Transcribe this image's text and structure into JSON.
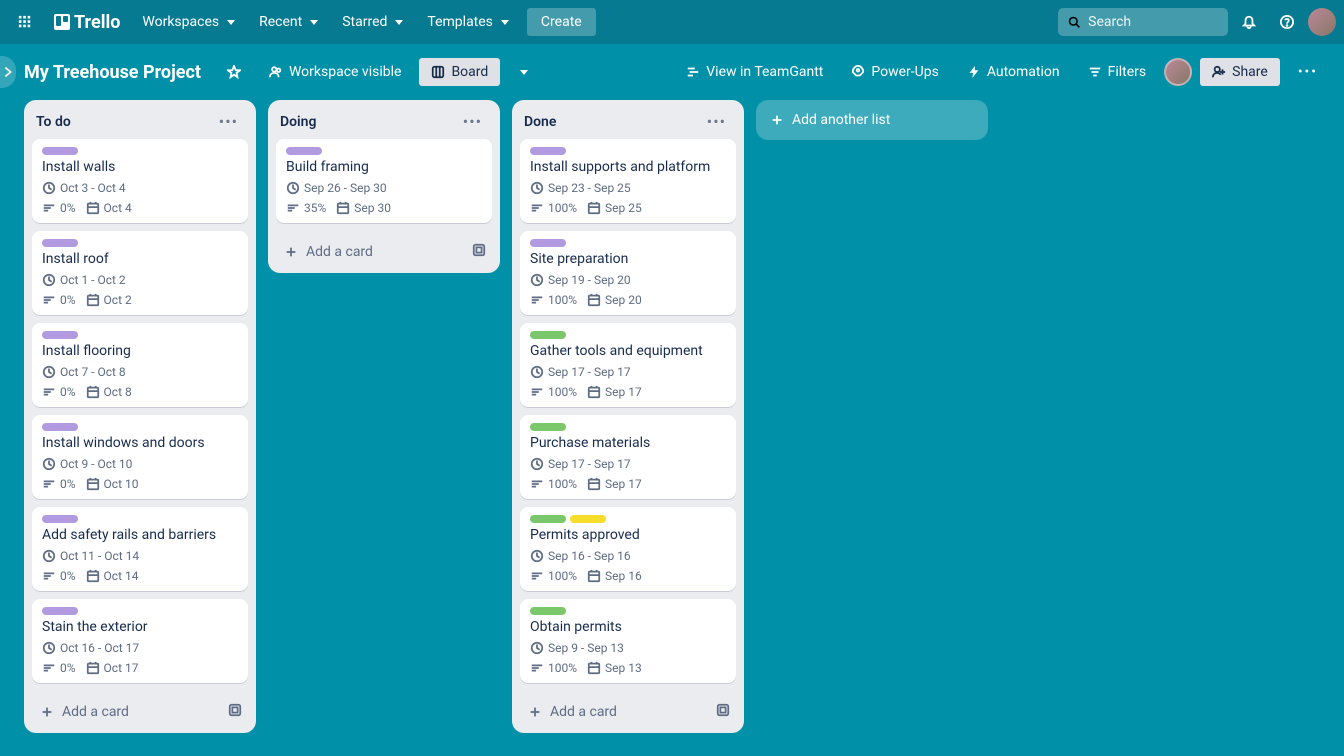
{
  "topnav": {
    "menus": [
      "Workspaces",
      "Recent",
      "Starred",
      "Templates"
    ],
    "create": "Create",
    "search_placeholder": "Search",
    "logo_text": "Trello"
  },
  "board_header": {
    "title": "My Treehouse Project",
    "visibility": "Workspace visible",
    "view_label": "Board",
    "view_teamgantt": "View in TeamGantt",
    "powerups": "Power-Ups",
    "automation": "Automation",
    "filters": "Filters",
    "share": "Share"
  },
  "add_list_label": "Add another list",
  "add_card_label": "Add a card",
  "lists": [
    {
      "title": "To do",
      "cards": [
        {
          "labels": [
            "purple"
          ],
          "title": "Install walls",
          "date_range": "Oct 3 - Oct 4",
          "progress": "0%",
          "due": "Oct 4"
        },
        {
          "labels": [
            "purple"
          ],
          "title": "Install roof",
          "date_range": "Oct 1 - Oct 2",
          "progress": "0%",
          "due": "Oct 2"
        },
        {
          "labels": [
            "purple"
          ],
          "title": "Install flooring",
          "date_range": "Oct 7 - Oct 8",
          "progress": "0%",
          "due": "Oct 8"
        },
        {
          "labels": [
            "purple"
          ],
          "title": "Install windows and doors",
          "date_range": "Oct 9 - Oct 10",
          "progress": "0%",
          "due": "Oct 10"
        },
        {
          "labels": [
            "purple"
          ],
          "title": "Add safety rails and barriers",
          "date_range": "Oct 11 - Oct 14",
          "progress": "0%",
          "due": "Oct 14"
        },
        {
          "labels": [
            "purple"
          ],
          "title": "Stain the exterior",
          "date_range": "Oct 16 - Oct 17",
          "progress": "0%",
          "due": "Oct 17"
        }
      ]
    },
    {
      "title": "Doing",
      "cards": [
        {
          "labels": [
            "purple"
          ],
          "title": "Build framing",
          "date_range": "Sep 26 - Sep 30",
          "progress": "35%",
          "due": "Sep 30"
        }
      ]
    },
    {
      "title": "Done",
      "cards": [
        {
          "labels": [
            "purple"
          ],
          "title": "Install supports and platform",
          "date_range": "Sep 23 - Sep 25",
          "progress": "100%",
          "due": "Sep 25"
        },
        {
          "labels": [
            "purple"
          ],
          "title": "Site preparation",
          "date_range": "Sep 19 - Sep 20",
          "progress": "100%",
          "due": "Sep 20"
        },
        {
          "labels": [
            "green"
          ],
          "title": "Gather tools and equipment",
          "date_range": "Sep 17 - Sep 17",
          "progress": "100%",
          "due": "Sep 17"
        },
        {
          "labels": [
            "green"
          ],
          "title": "Purchase materials",
          "date_range": "Sep 17 - Sep 17",
          "progress": "100%",
          "due": "Sep 17"
        },
        {
          "labels": [
            "green",
            "yellow"
          ],
          "title": "Permits approved",
          "date_range": "Sep 16 - Sep 16",
          "progress": "100%",
          "due": "Sep 16"
        },
        {
          "labels": [
            "green"
          ],
          "title": "Obtain permits",
          "date_range": "Sep 9 - Sep 13",
          "progress": "100%",
          "due": "Sep 13"
        }
      ]
    }
  ]
}
